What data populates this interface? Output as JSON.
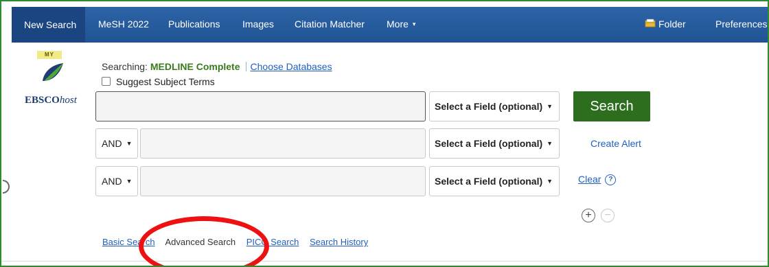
{
  "nav": {
    "items": [
      "New Search",
      "MeSH 2022",
      "Publications",
      "Images",
      "Citation Matcher",
      "More"
    ],
    "folder": "Folder",
    "preferences": "Preferences"
  },
  "logo": {
    "badge": "MY",
    "brand": "EBSCO",
    "brand_suffix": "host"
  },
  "searching": {
    "label": "Searching: ",
    "database": "MEDLINE Complete",
    "choose_link": "Choose Databases"
  },
  "suggest_label": "Suggest Subject Terms",
  "search_rows": [
    {
      "bool": "",
      "value": "",
      "field": "Select a Field (optional)"
    },
    {
      "bool": "AND",
      "value": "",
      "field": "Select a Field (optional)"
    },
    {
      "bool": "AND",
      "value": "",
      "field": "Select a Field (optional)"
    }
  ],
  "actions": {
    "search": "Search",
    "create_alert": "Create Alert",
    "clear": "Clear",
    "help": "?"
  },
  "bottom_links": {
    "basic": "Basic Search",
    "advanced": "Advanced Search",
    "pico": "PICO Search",
    "history": "Search History"
  },
  "colors": {
    "nav_bg": "#1f5394",
    "search_button": "#2c6e1e",
    "database_text": "#3a7a1e",
    "annotation": "#ee1111",
    "frame_border": "#2e8b2e"
  }
}
